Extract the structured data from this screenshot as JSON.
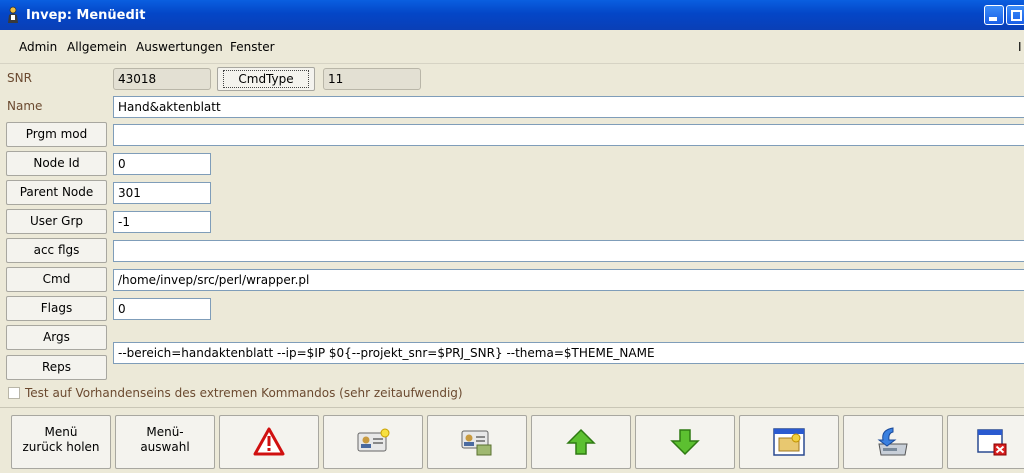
{
  "window": {
    "title": "Invep: Menüedit"
  },
  "menu": {
    "items": [
      "Admin",
      "Allgemein",
      "Auswertungen",
      "Fenster"
    ],
    "right_char": "I"
  },
  "form": {
    "snr": {
      "label": "SNR",
      "value": "43018"
    },
    "cmdtype": {
      "label": "CmdType",
      "value": "11"
    },
    "name": {
      "label": "Name",
      "value": "Hand&aktenblatt"
    },
    "prgm_mod": {
      "label": "Prgm mod",
      "value": ""
    },
    "node_id": {
      "label": "Node Id",
      "value": "0"
    },
    "parent_node": {
      "label": "Parent Node",
      "value": "301"
    },
    "user_grp": {
      "label": "User Grp",
      "value": "-1"
    },
    "acc_flgs": {
      "label": "acc flgs",
      "value": ""
    },
    "cmd": {
      "label": "Cmd",
      "value": "/home/invep/src/perl/wrapper.pl"
    },
    "flags": {
      "label": "Flags",
      "value": "0"
    },
    "args": {
      "label": "Args",
      "value": "--bereich=handaktenblatt --ip=$IP $0{--projekt_snr=$PRJ_SNR} --thema=$THEME_NAME"
    },
    "reps": {
      "label": "Reps"
    },
    "check_label": "Test auf Vorhandenseins des extremen Kommandos (sehr zeitaufwendig)"
  },
  "toolbar": {
    "menu_back": "Menü\nzurück holen",
    "menu_select": "Menü-\nauswahl",
    "icons": [
      "warning-icon",
      "new-card-icon",
      "card-open-icon",
      "arrow-up-icon",
      "arrow-down-icon",
      "window-image-icon",
      "save-drive-icon",
      "close-window-icon"
    ]
  },
  "colors": {
    "title_bar": "#0446c7",
    "background": "#ece9d8",
    "label_brown": "#6b4a30",
    "field_border": "#7f9db9"
  }
}
